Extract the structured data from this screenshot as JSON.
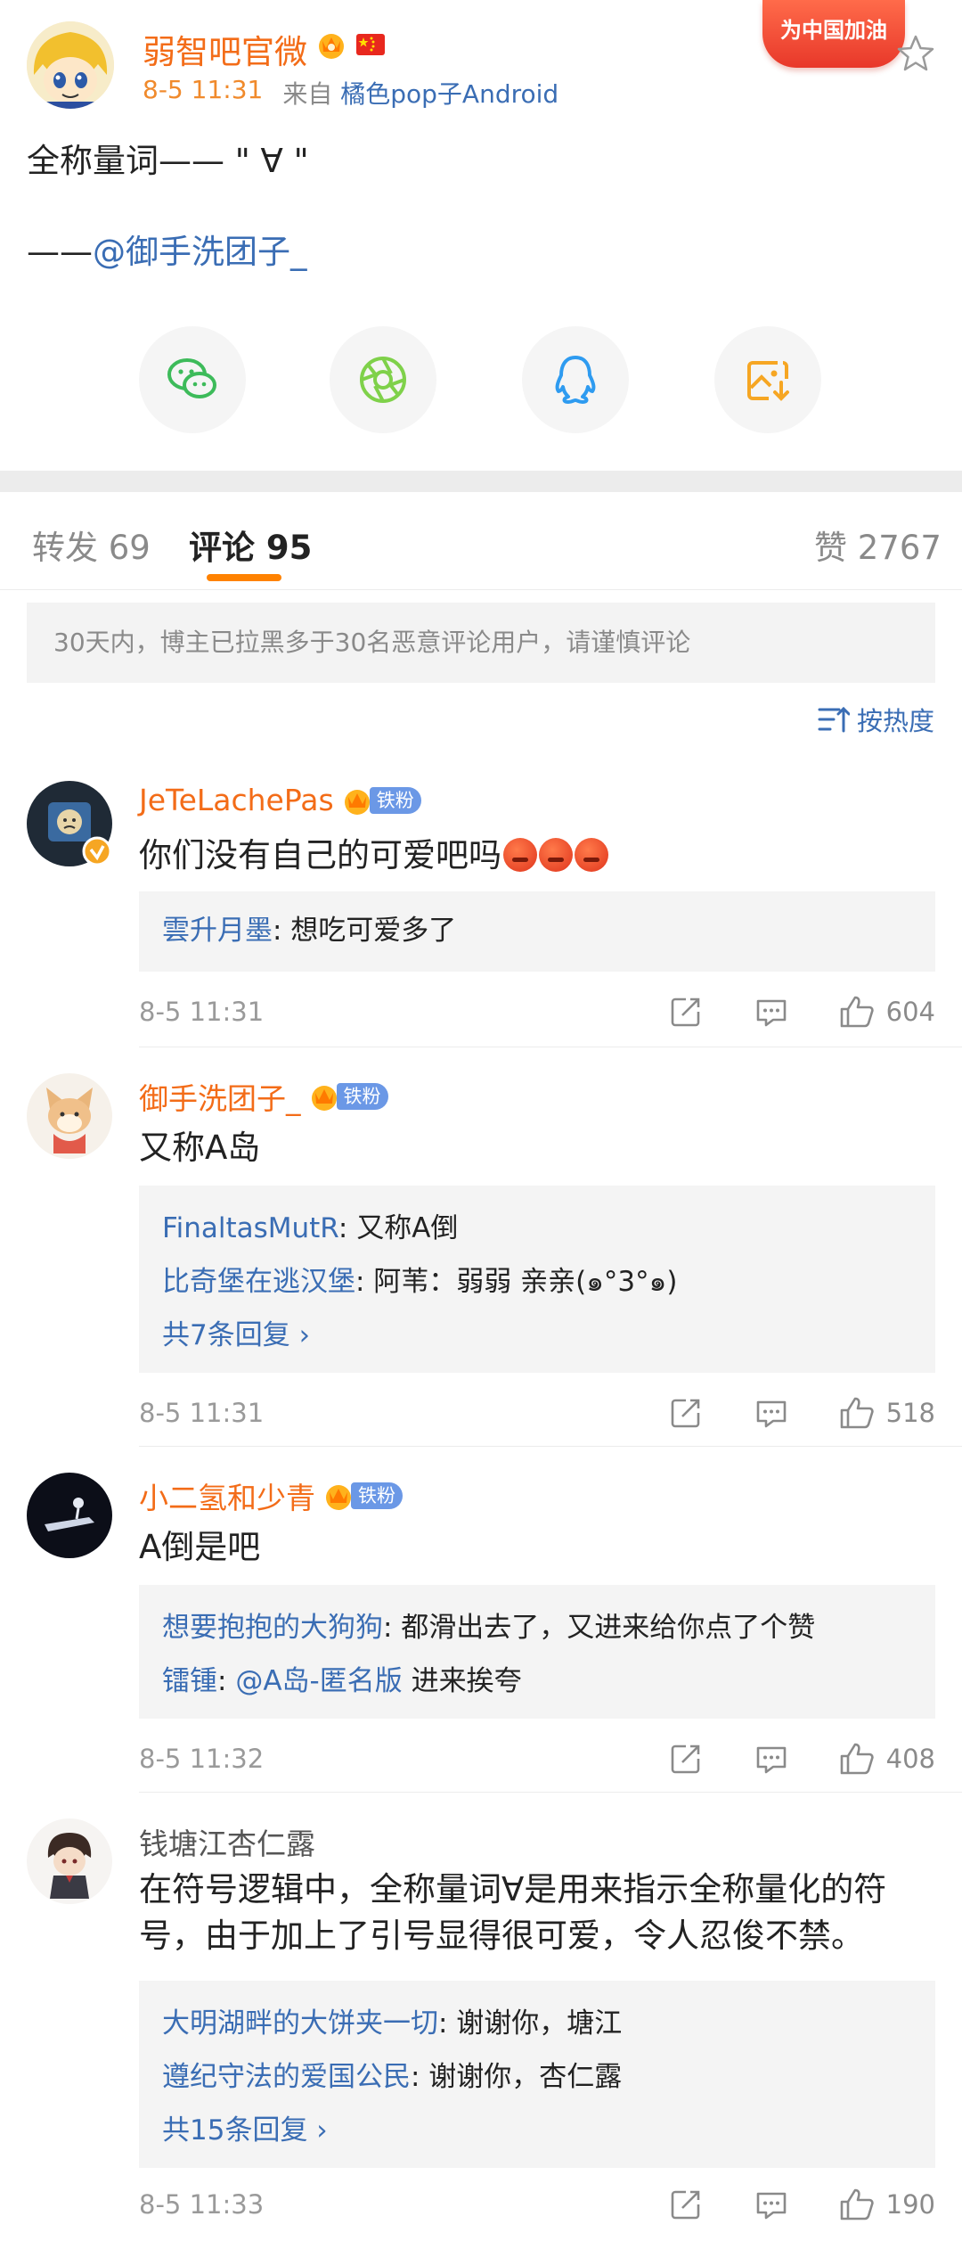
{
  "post": {
    "author": "弱智吧官微",
    "time": "8-5 11:31",
    "source_prefix": "来自",
    "source": "橘色pop子Android",
    "campaign_badge": "为中国加油",
    "text_line1": "全称量词—— \" ∀ \"",
    "text_line2_prefix": "——",
    "text_line2_mention": "@御手洗团子_",
    "share": [
      "wechat-icon",
      "moments-icon",
      "qq-icon",
      "save-image-icon"
    ]
  },
  "tabs": {
    "reposts": "转发 69",
    "comments": "评论 95",
    "likes": "赞 2767"
  },
  "notice": "30天内，博主已拉黑多于30名恶意评论用户，请谨慎评论",
  "sort_label": "按热度",
  "fan_badge_label": "铁粉",
  "colors": {
    "accent": "#ff8200",
    "link": "#3a6db4",
    "name": "#f36c18"
  },
  "comments": [
    {
      "name": "JeTeLachePas",
      "text": "你们没有自己的可爱吧吗",
      "replies": [
        {
          "who": "雲升月墨",
          "text": ": 想吃可爱多了"
        }
      ],
      "more": "",
      "time": "8-5 11:31",
      "likes": "604"
    },
    {
      "name": "御手洗团子_",
      "text": "又称A岛",
      "replies": [
        {
          "who": "FinaltasMutR",
          "text": ": 又称A倒"
        },
        {
          "who": "比奇堡在逃汉堡",
          "text": ": 阿苇：弱弱 亲亲(๑°3°๑)"
        }
      ],
      "more": "共7条回复 ›",
      "time": "8-5 11:31",
      "likes": "518"
    },
    {
      "name": "小二氢和少青",
      "text": "A倒是吧",
      "replies": [
        {
          "who": "想要抱抱的大狗狗",
          "text": ": 都滑出去了，又进来给你点了个赞"
        },
        {
          "who": "镭锺",
          "text": ": ",
          "mention": "@A岛-匿名版",
          "text2": " 进来挨夸"
        }
      ],
      "more": "",
      "time": "8-5 11:32",
      "likes": "408"
    },
    {
      "name": "钱塘江杏仁露",
      "text": "在符号逻辑中，全称量词∀是用来指示全称量化的符号，由于加上了引号显得很可爱，令人忍俊不禁。",
      "replies": [
        {
          "who": "大明湖畔的大饼夹一切",
          "text": ": 谢谢你，塘江"
        },
        {
          "who": "遵纪守法的爱国公民",
          "text": ": 谢谢你，杏仁露"
        }
      ],
      "more": "共15条回复 ›",
      "time": "8-5 11:33",
      "likes": "190"
    }
  ]
}
